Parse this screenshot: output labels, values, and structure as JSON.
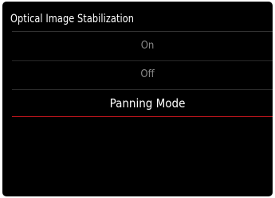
{
  "header": {
    "title": "Optical Image Stabilization"
  },
  "menu": {
    "items": [
      {
        "label": "On",
        "state": "dim"
      },
      {
        "label": "Off",
        "state": "dim"
      },
      {
        "label": "Panning Mode",
        "state": "selected"
      }
    ],
    "selected_index": 2
  },
  "colors": {
    "background": "#000000",
    "title_text": "#ffffff",
    "dim_text": "#8a8a8a",
    "selected_text": "#ffffff",
    "selection_rule": "#b3141b"
  }
}
